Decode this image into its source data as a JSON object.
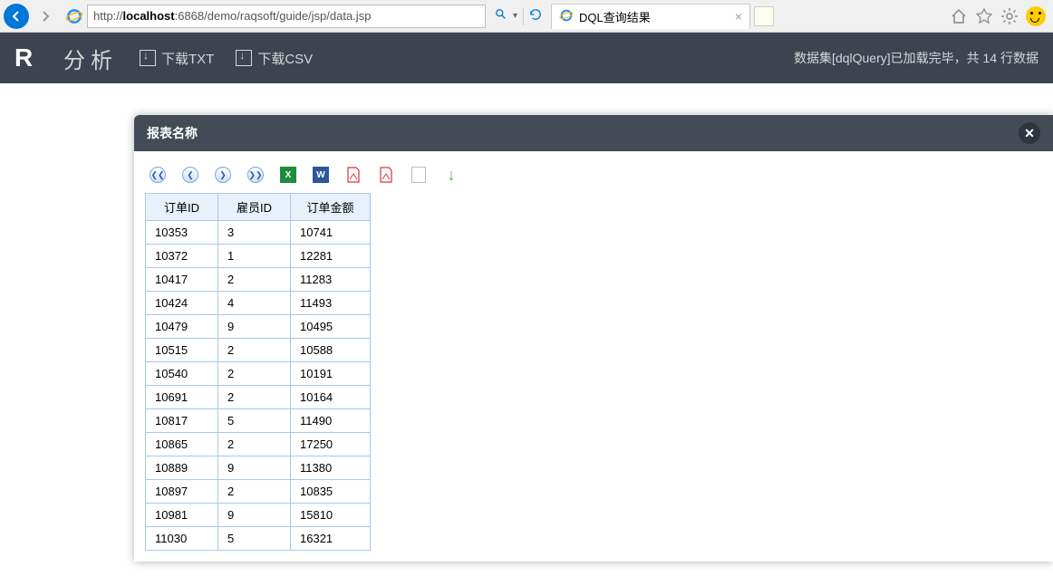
{
  "browser": {
    "url_pre": "http://",
    "url_host": "localhost",
    "url_path": ":6868/demo/raqsoft/guide/jsp/data.jsp",
    "tab_title": "DQL查询结果"
  },
  "header": {
    "logo": "R",
    "analyze": "分析",
    "download_txt": "下载TXT",
    "download_csv": "下载CSV",
    "status": "数据集[dqlQuery]已加载完毕，共 14 行数据"
  },
  "modal": {
    "title": "报表名称"
  },
  "table": {
    "headers": [
      "订单ID",
      "雇员ID",
      "订单金额"
    ],
    "rows": [
      [
        "10353",
        "3",
        "10741"
      ],
      [
        "10372",
        "1",
        "12281"
      ],
      [
        "10417",
        "2",
        "11283"
      ],
      [
        "10424",
        "4",
        "11493"
      ],
      [
        "10479",
        "9",
        "10495"
      ],
      [
        "10515",
        "2",
        "10588"
      ],
      [
        "10540",
        "2",
        "10191"
      ],
      [
        "10691",
        "2",
        "10164"
      ],
      [
        "10817",
        "5",
        "11490"
      ],
      [
        "10865",
        "2",
        "17250"
      ],
      [
        "10889",
        "9",
        "11380"
      ],
      [
        "10897",
        "2",
        "10835"
      ],
      [
        "10981",
        "9",
        "15810"
      ],
      [
        "11030",
        "5",
        "16321"
      ]
    ]
  }
}
